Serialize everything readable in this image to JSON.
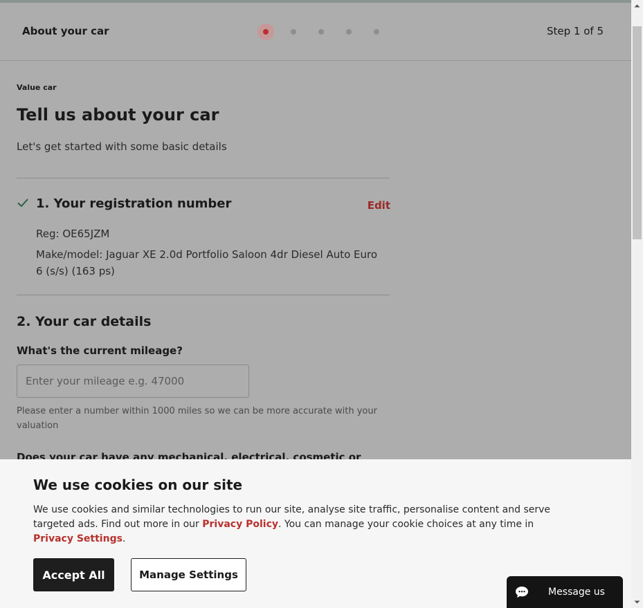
{
  "header": {
    "title": "About your car",
    "step_text": "Step 1 of 5",
    "steps_total": 5,
    "current_step": 1
  },
  "main": {
    "eyebrow": "Value car",
    "title": "Tell us about your car",
    "subtitle": "Let's get started with some basic details",
    "section1": {
      "title": "1. Your registration number",
      "edit_label": "Edit",
      "reg": "Reg: OE65JZM",
      "make_model": "Make/model: Jaguar XE 2.0d Portfolio Saloon 4dr Diesel Auto Euro 6 (s/s) (163 ps)"
    },
    "section2": {
      "title": "2. Your car details",
      "mileage_label": "What's the current mileage?",
      "mileage_placeholder": "Enter your mileage e.g. 47000",
      "mileage_value": "",
      "mileage_hint": "Please enter a number within 1000 miles so we can be more accurate with your valuation",
      "next_question": "Does your car have any mechanical, electrical, cosmetic or"
    }
  },
  "cookie_banner": {
    "title": "We use cookies on our site",
    "body_1": "We use cookies and similar technologies to run our site, analyse site traffic, personalise content and serve targeted ads. Find out more in our ",
    "privacy_policy_link": "Privacy Policy",
    "body_2": ". You can manage your cookie choices at any time in ",
    "privacy_settings_link": "Privacy Settings",
    "body_3": ".",
    "accept_label": "Accept All",
    "manage_label": "Manage Settings"
  },
  "chat": {
    "label": "Message us"
  },
  "colors": {
    "accent": "#b8312f",
    "dark_button": "#1e1e1e",
    "overlay_bg": "#adadad",
    "banner_bg": "#f5f6f5"
  },
  "icons": {
    "check": "check-icon",
    "chat": "chat-bubble-icon"
  }
}
